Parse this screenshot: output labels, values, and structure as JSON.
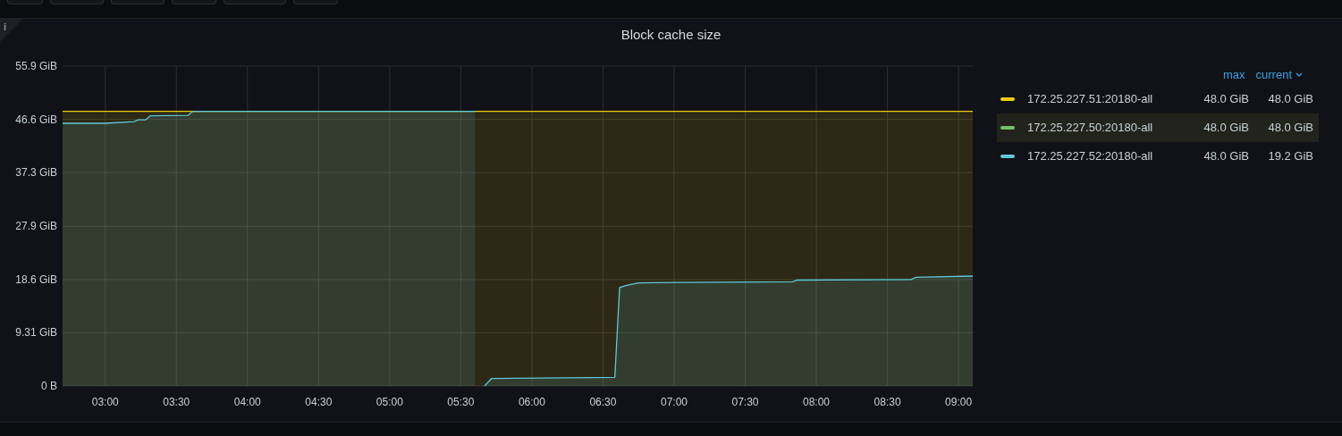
{
  "panel": {
    "title": "Block cache size",
    "info_icon": "i",
    "chart_data": {
      "type": "area",
      "stacked": false,
      "grid": true,
      "xlim": [
        162,
        546
      ],
      "ylim": [
        0,
        55.9
      ],
      "x": [
        162,
        180,
        192,
        194,
        197,
        199,
        215,
        217,
        336,
        338,
        340,
        343,
        395,
        397,
        400,
        405,
        420,
        470,
        472,
        520,
        522,
        546
      ],
      "xticks": [
        {
          "value": 180,
          "label": "03:00"
        },
        {
          "value": 210,
          "label": "03:30"
        },
        {
          "value": 240,
          "label": "04:00"
        },
        {
          "value": 270,
          "label": "04:30"
        },
        {
          "value": 300,
          "label": "05:00"
        },
        {
          "value": 330,
          "label": "05:30"
        },
        {
          "value": 360,
          "label": "06:00"
        },
        {
          "value": 390,
          "label": "06:30"
        },
        {
          "value": 420,
          "label": "07:00"
        },
        {
          "value": 450,
          "label": "07:30"
        },
        {
          "value": 480,
          "label": "08:00"
        },
        {
          "value": 510,
          "label": "08:30"
        },
        {
          "value": 540,
          "label": "09:00"
        }
      ],
      "yticks": [
        {
          "value": 0,
          "label": "0 B"
        },
        {
          "value": 9.31,
          "label": "9.31 GiB"
        },
        {
          "value": 18.6,
          "label": "18.6 GiB"
        },
        {
          "value": 27.9,
          "label": "27.9 GiB"
        },
        {
          "value": 37.3,
          "label": "37.3 GiB"
        },
        {
          "value": 46.6,
          "label": "46.6 GiB"
        },
        {
          "value": 55.9,
          "label": "55.9 GiB"
        }
      ],
      "series": [
        {
          "name": "172.25.227.51:20180-all",
          "color": "#f2cc0c",
          "values": [
            48,
            48,
            48,
            48,
            48,
            48,
            48,
            48,
            48,
            48,
            48,
            48,
            48,
            48,
            48,
            48,
            48,
            48,
            48,
            48,
            48,
            48
          ]
        },
        {
          "name": "172.25.227.52:20180-all",
          "color": "#5ec8d8",
          "values": [
            45.9,
            45.9,
            46.2,
            46.5,
            46.5,
            47.2,
            47.3,
            48,
            48,
            null,
            0,
            1.3,
            1.5,
            17.2,
            17.6,
            18.0,
            18.1,
            18.2,
            18.5,
            18.6,
            19.0,
            19.2
          ]
        }
      ]
    },
    "legend": {
      "columns": [
        {
          "label": "max",
          "sort_caret": false
        },
        {
          "label": "current",
          "sort_caret": true
        }
      ],
      "rows": [
        {
          "max": "48.0 GiB",
          "current": "48.0 GiB",
          "highlighted": false
        },
        {
          "name": "172.25.227.50:20180-all",
          "color": "#73bf69",
          "max": "48.0 GiB",
          "current": "48.0 GiB",
          "highlighted": true
        },
        {
          "max": "48.0 GiB",
          "current": "19.2 GiB",
          "highlighted": false
        }
      ]
    }
  }
}
